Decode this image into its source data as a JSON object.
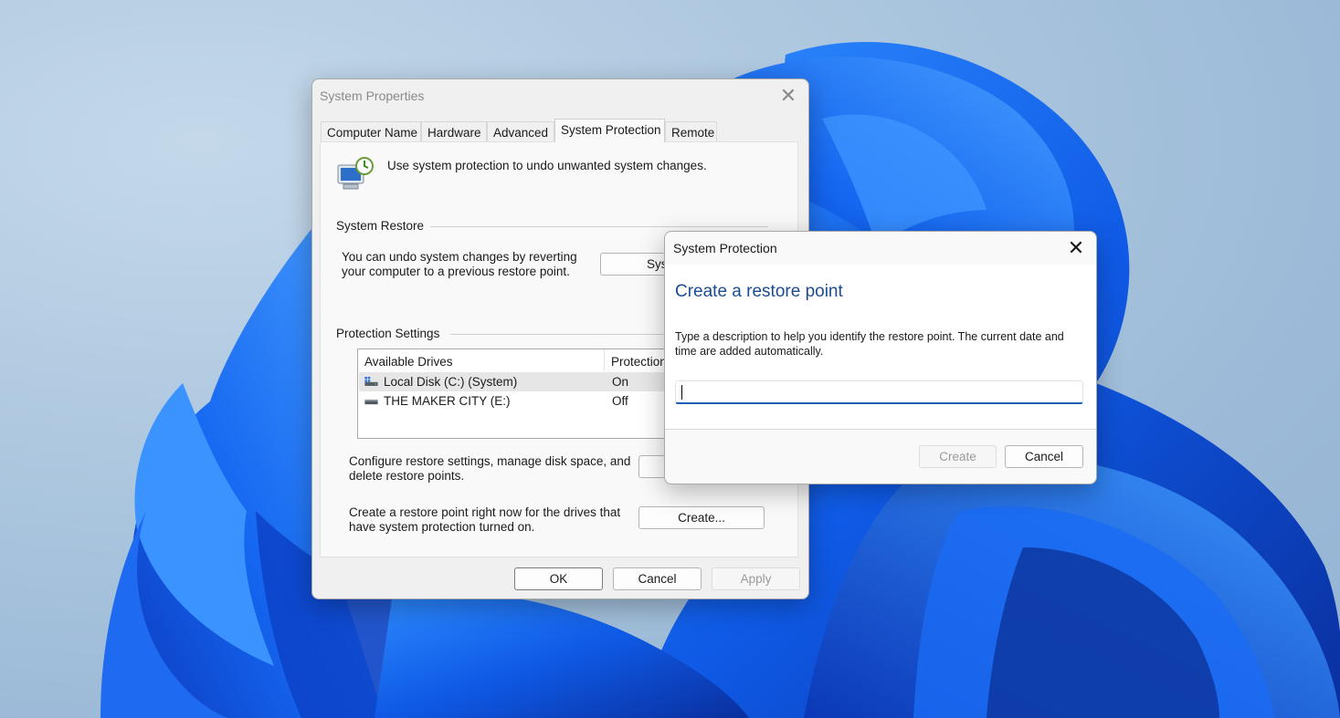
{
  "system_properties": {
    "title": "System Properties",
    "tabs": [
      "Computer Name",
      "Hardware",
      "Advanced",
      "System Protection",
      "Remote"
    ],
    "active_tab": "System Protection",
    "intro_text": "Use system protection to undo unwanted system changes.",
    "system_restore": {
      "group_title": "System Restore",
      "description_line1": "You can undo system changes by reverting",
      "description_line2": "your computer to a previous restore point.",
      "button_label": "Sys"
    },
    "protection_settings": {
      "group_title": "Protection Settings",
      "columns": [
        "Available Drives",
        "Protection"
      ],
      "drives": [
        {
          "name": "Local Disk (C:) (System)",
          "protection": "On",
          "selected": true,
          "icon": "system-drive-icon"
        },
        {
          "name": "THE MAKER CITY (E:)",
          "protection": "Off",
          "selected": false,
          "icon": "drive-icon"
        }
      ],
      "configure_line1": "Configure restore settings, manage disk space, and",
      "configure_line2": "delete restore points.",
      "create_line1": "Create a restore point right now for the drives that",
      "create_line2": "have system protection turned on.",
      "create_button": "Create..."
    },
    "buttons": {
      "ok": "OK",
      "cancel": "Cancel",
      "apply": "Apply"
    }
  },
  "restore_dialog": {
    "title": "System Protection",
    "heading": "Create a restore point",
    "description": "Type a description to help you identify the restore point. The current date and time are added automatically.",
    "input_value": "",
    "buttons": {
      "create": "Create",
      "cancel": "Cancel"
    }
  },
  "colors": {
    "heading_blue": "#1b4c93",
    "input_focus": "#1a5fb4",
    "wallpaper_blue": "#1460e8"
  }
}
